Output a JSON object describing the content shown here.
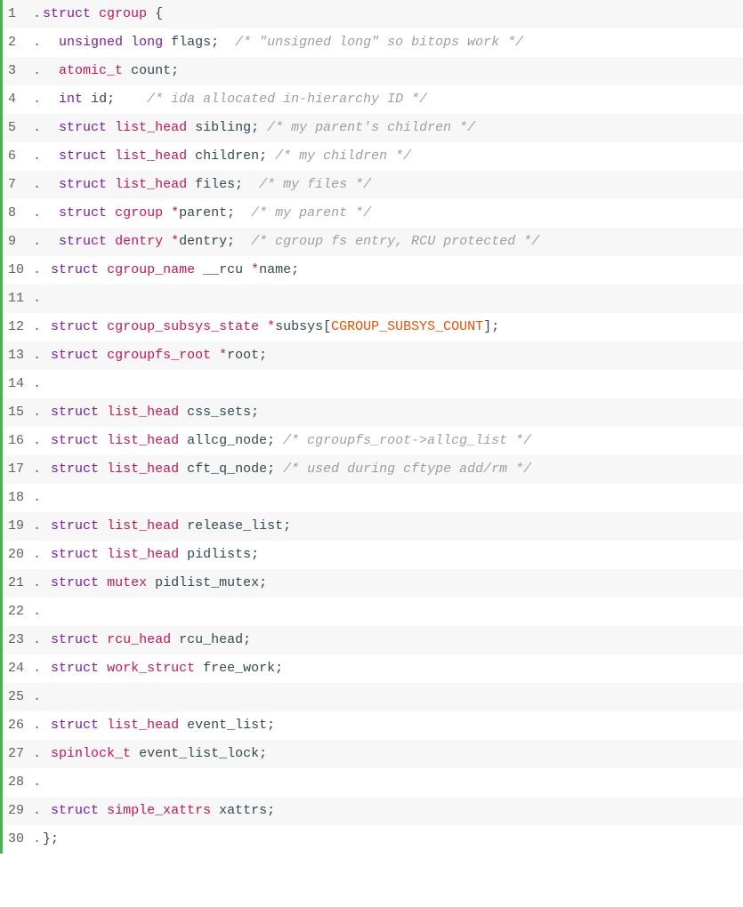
{
  "colors": {
    "border": "#4caf50",
    "keyword": "#7b1fa2",
    "type": "#c2185b",
    "identifier": "#37474f",
    "comment": "#9e9e9e",
    "constant": "#e65100"
  },
  "lines": [
    {
      "n": "1",
      "tokens": [
        {
          "cls": "kw",
          "t": "struct"
        },
        {
          "cls": "",
          "t": " "
        },
        {
          "cls": "type",
          "t": "cgroup"
        },
        {
          "cls": "",
          "t": " "
        },
        {
          "cls": "punct",
          "t": "{"
        }
      ]
    },
    {
      "n": "2",
      "tokens": [
        {
          "cls": "",
          "t": "  "
        },
        {
          "cls": "kw",
          "t": "unsigned"
        },
        {
          "cls": "",
          "t": " "
        },
        {
          "cls": "kw",
          "t": "long"
        },
        {
          "cls": "",
          "t": " "
        },
        {
          "cls": "ident",
          "t": "flags"
        },
        {
          "cls": "punct",
          "t": ";"
        },
        {
          "cls": "",
          "t": "  "
        },
        {
          "cls": "comment",
          "t": "/* \"unsigned long\" so bitops work */"
        }
      ]
    },
    {
      "n": "3",
      "tokens": [
        {
          "cls": "",
          "t": "  "
        },
        {
          "cls": "type",
          "t": "atomic_t"
        },
        {
          "cls": "",
          "t": " "
        },
        {
          "cls": "ident",
          "t": "count"
        },
        {
          "cls": "punct",
          "t": ";"
        }
      ]
    },
    {
      "n": "4",
      "tokens": [
        {
          "cls": "",
          "t": "  "
        },
        {
          "cls": "kw",
          "t": "int"
        },
        {
          "cls": "",
          "t": " "
        },
        {
          "cls": "ident",
          "t": "id"
        },
        {
          "cls": "punct",
          "t": ";"
        },
        {
          "cls": "",
          "t": "    "
        },
        {
          "cls": "comment",
          "t": "/* ida allocated in-hierarchy ID */"
        }
      ]
    },
    {
      "n": "5",
      "tokens": [
        {
          "cls": "",
          "t": "  "
        },
        {
          "cls": "kw",
          "t": "struct"
        },
        {
          "cls": "",
          "t": " "
        },
        {
          "cls": "type",
          "t": "list_head"
        },
        {
          "cls": "",
          "t": " "
        },
        {
          "cls": "ident",
          "t": "sibling"
        },
        {
          "cls": "punct",
          "t": ";"
        },
        {
          "cls": "",
          "t": " "
        },
        {
          "cls": "comment",
          "t": "/* my parent's children */"
        }
      ]
    },
    {
      "n": "6",
      "tokens": [
        {
          "cls": "",
          "t": "  "
        },
        {
          "cls": "kw",
          "t": "struct"
        },
        {
          "cls": "",
          "t": " "
        },
        {
          "cls": "type",
          "t": "list_head"
        },
        {
          "cls": "",
          "t": " "
        },
        {
          "cls": "ident",
          "t": "children"
        },
        {
          "cls": "punct",
          "t": ";"
        },
        {
          "cls": "",
          "t": " "
        },
        {
          "cls": "comment",
          "t": "/* my children */"
        }
      ]
    },
    {
      "n": "7",
      "tokens": [
        {
          "cls": "",
          "t": "  "
        },
        {
          "cls": "kw",
          "t": "struct"
        },
        {
          "cls": "",
          "t": " "
        },
        {
          "cls": "type",
          "t": "list_head"
        },
        {
          "cls": "",
          "t": " "
        },
        {
          "cls": "ident",
          "t": "files"
        },
        {
          "cls": "punct",
          "t": ";"
        },
        {
          "cls": "",
          "t": "  "
        },
        {
          "cls": "comment",
          "t": "/* my files */"
        }
      ]
    },
    {
      "n": "8",
      "tokens": [
        {
          "cls": "",
          "t": "  "
        },
        {
          "cls": "kw",
          "t": "struct"
        },
        {
          "cls": "",
          "t": " "
        },
        {
          "cls": "type",
          "t": "cgroup"
        },
        {
          "cls": "",
          "t": " "
        },
        {
          "cls": "op",
          "t": "*"
        },
        {
          "cls": "ident",
          "t": "parent"
        },
        {
          "cls": "punct",
          "t": ";"
        },
        {
          "cls": "",
          "t": "  "
        },
        {
          "cls": "comment",
          "t": "/* my parent */"
        }
      ]
    },
    {
      "n": "9",
      "tokens": [
        {
          "cls": "",
          "t": "  "
        },
        {
          "cls": "kw",
          "t": "struct"
        },
        {
          "cls": "",
          "t": " "
        },
        {
          "cls": "type",
          "t": "dentry"
        },
        {
          "cls": "",
          "t": " "
        },
        {
          "cls": "op",
          "t": "*"
        },
        {
          "cls": "ident",
          "t": "dentry"
        },
        {
          "cls": "punct",
          "t": ";"
        },
        {
          "cls": "",
          "t": "  "
        },
        {
          "cls": "comment",
          "t": "/* cgroup fs entry, RCU protected */"
        }
      ]
    },
    {
      "n": "10",
      "tokens": [
        {
          "cls": "",
          "t": " "
        },
        {
          "cls": "kw",
          "t": "struct"
        },
        {
          "cls": "",
          "t": " "
        },
        {
          "cls": "type",
          "t": "cgroup_name"
        },
        {
          "cls": "",
          "t": " "
        },
        {
          "cls": "ident",
          "t": "__rcu"
        },
        {
          "cls": "",
          "t": " "
        },
        {
          "cls": "op",
          "t": "*"
        },
        {
          "cls": "ident",
          "t": "name"
        },
        {
          "cls": "punct",
          "t": ";"
        }
      ]
    },
    {
      "n": "11",
      "tokens": []
    },
    {
      "n": "12",
      "tokens": [
        {
          "cls": "",
          "t": " "
        },
        {
          "cls": "kw",
          "t": "struct"
        },
        {
          "cls": "",
          "t": " "
        },
        {
          "cls": "type",
          "t": "cgroup_subsys_state"
        },
        {
          "cls": "",
          "t": " "
        },
        {
          "cls": "op",
          "t": "*"
        },
        {
          "cls": "ident",
          "t": "subsys"
        },
        {
          "cls": "punct",
          "t": "["
        },
        {
          "cls": "num-const",
          "t": "CGROUP_SUBSYS_COUNT"
        },
        {
          "cls": "punct",
          "t": "];"
        }
      ]
    },
    {
      "n": "13",
      "tokens": [
        {
          "cls": "",
          "t": " "
        },
        {
          "cls": "kw",
          "t": "struct"
        },
        {
          "cls": "",
          "t": " "
        },
        {
          "cls": "type",
          "t": "cgroupfs_root"
        },
        {
          "cls": "",
          "t": " "
        },
        {
          "cls": "op",
          "t": "*"
        },
        {
          "cls": "ident",
          "t": "root"
        },
        {
          "cls": "punct",
          "t": ";"
        }
      ]
    },
    {
      "n": "14",
      "tokens": []
    },
    {
      "n": "15",
      "tokens": [
        {
          "cls": "",
          "t": " "
        },
        {
          "cls": "kw",
          "t": "struct"
        },
        {
          "cls": "",
          "t": " "
        },
        {
          "cls": "type",
          "t": "list_head"
        },
        {
          "cls": "",
          "t": " "
        },
        {
          "cls": "ident",
          "t": "css_sets"
        },
        {
          "cls": "punct",
          "t": ";"
        }
      ]
    },
    {
      "n": "16",
      "tokens": [
        {
          "cls": "",
          "t": " "
        },
        {
          "cls": "kw",
          "t": "struct"
        },
        {
          "cls": "",
          "t": " "
        },
        {
          "cls": "type",
          "t": "list_head"
        },
        {
          "cls": "",
          "t": " "
        },
        {
          "cls": "ident",
          "t": "allcg_node"
        },
        {
          "cls": "punct",
          "t": ";"
        },
        {
          "cls": "",
          "t": " "
        },
        {
          "cls": "comment",
          "t": "/* cgroupfs_root->allcg_list */"
        }
      ]
    },
    {
      "n": "17",
      "tokens": [
        {
          "cls": "",
          "t": " "
        },
        {
          "cls": "kw",
          "t": "struct"
        },
        {
          "cls": "",
          "t": " "
        },
        {
          "cls": "type",
          "t": "list_head"
        },
        {
          "cls": "",
          "t": " "
        },
        {
          "cls": "ident",
          "t": "cft_q_node"
        },
        {
          "cls": "punct",
          "t": ";"
        },
        {
          "cls": "",
          "t": " "
        },
        {
          "cls": "comment",
          "t": "/* used during cftype add/rm */"
        }
      ]
    },
    {
      "n": "18",
      "tokens": []
    },
    {
      "n": "19",
      "tokens": [
        {
          "cls": "",
          "t": " "
        },
        {
          "cls": "kw",
          "t": "struct"
        },
        {
          "cls": "",
          "t": " "
        },
        {
          "cls": "type",
          "t": "list_head"
        },
        {
          "cls": "",
          "t": " "
        },
        {
          "cls": "ident",
          "t": "release_list"
        },
        {
          "cls": "punct",
          "t": ";"
        }
      ]
    },
    {
      "n": "20",
      "tokens": [
        {
          "cls": "",
          "t": " "
        },
        {
          "cls": "kw",
          "t": "struct"
        },
        {
          "cls": "",
          "t": " "
        },
        {
          "cls": "type",
          "t": "list_head"
        },
        {
          "cls": "",
          "t": " "
        },
        {
          "cls": "ident",
          "t": "pidlists"
        },
        {
          "cls": "punct",
          "t": ";"
        }
      ]
    },
    {
      "n": "21",
      "tokens": [
        {
          "cls": "",
          "t": " "
        },
        {
          "cls": "kw",
          "t": "struct"
        },
        {
          "cls": "",
          "t": " "
        },
        {
          "cls": "type",
          "t": "mutex"
        },
        {
          "cls": "",
          "t": " "
        },
        {
          "cls": "ident",
          "t": "pidlist_mutex"
        },
        {
          "cls": "punct",
          "t": ";"
        }
      ]
    },
    {
      "n": "22",
      "tokens": []
    },
    {
      "n": "23",
      "tokens": [
        {
          "cls": "",
          "t": " "
        },
        {
          "cls": "kw",
          "t": "struct"
        },
        {
          "cls": "",
          "t": " "
        },
        {
          "cls": "type",
          "t": "rcu_head"
        },
        {
          "cls": "",
          "t": " "
        },
        {
          "cls": "ident",
          "t": "rcu_head"
        },
        {
          "cls": "punct",
          "t": ";"
        }
      ]
    },
    {
      "n": "24",
      "tokens": [
        {
          "cls": "",
          "t": " "
        },
        {
          "cls": "kw",
          "t": "struct"
        },
        {
          "cls": "",
          "t": " "
        },
        {
          "cls": "type",
          "t": "work_struct"
        },
        {
          "cls": "",
          "t": " "
        },
        {
          "cls": "ident",
          "t": "free_work"
        },
        {
          "cls": "punct",
          "t": ";"
        }
      ]
    },
    {
      "n": "25",
      "tokens": []
    },
    {
      "n": "26",
      "tokens": [
        {
          "cls": "",
          "t": " "
        },
        {
          "cls": "kw",
          "t": "struct"
        },
        {
          "cls": "",
          "t": " "
        },
        {
          "cls": "type",
          "t": "list_head"
        },
        {
          "cls": "",
          "t": " "
        },
        {
          "cls": "ident",
          "t": "event_list"
        },
        {
          "cls": "punct",
          "t": ";"
        }
      ]
    },
    {
      "n": "27",
      "tokens": [
        {
          "cls": "",
          "t": " "
        },
        {
          "cls": "type",
          "t": "spinlock_t"
        },
        {
          "cls": "",
          "t": " "
        },
        {
          "cls": "ident",
          "t": "event_list_lock"
        },
        {
          "cls": "punct",
          "t": ";"
        }
      ]
    },
    {
      "n": "28",
      "tokens": []
    },
    {
      "n": "29",
      "tokens": [
        {
          "cls": "",
          "t": " "
        },
        {
          "cls": "kw",
          "t": "struct"
        },
        {
          "cls": "",
          "t": " "
        },
        {
          "cls": "type",
          "t": "simple_xattrs"
        },
        {
          "cls": "",
          "t": " "
        },
        {
          "cls": "ident",
          "t": "xattrs"
        },
        {
          "cls": "punct",
          "t": ";"
        }
      ]
    },
    {
      "n": "30",
      "tokens": [
        {
          "cls": "punct",
          "t": "};"
        }
      ]
    }
  ]
}
